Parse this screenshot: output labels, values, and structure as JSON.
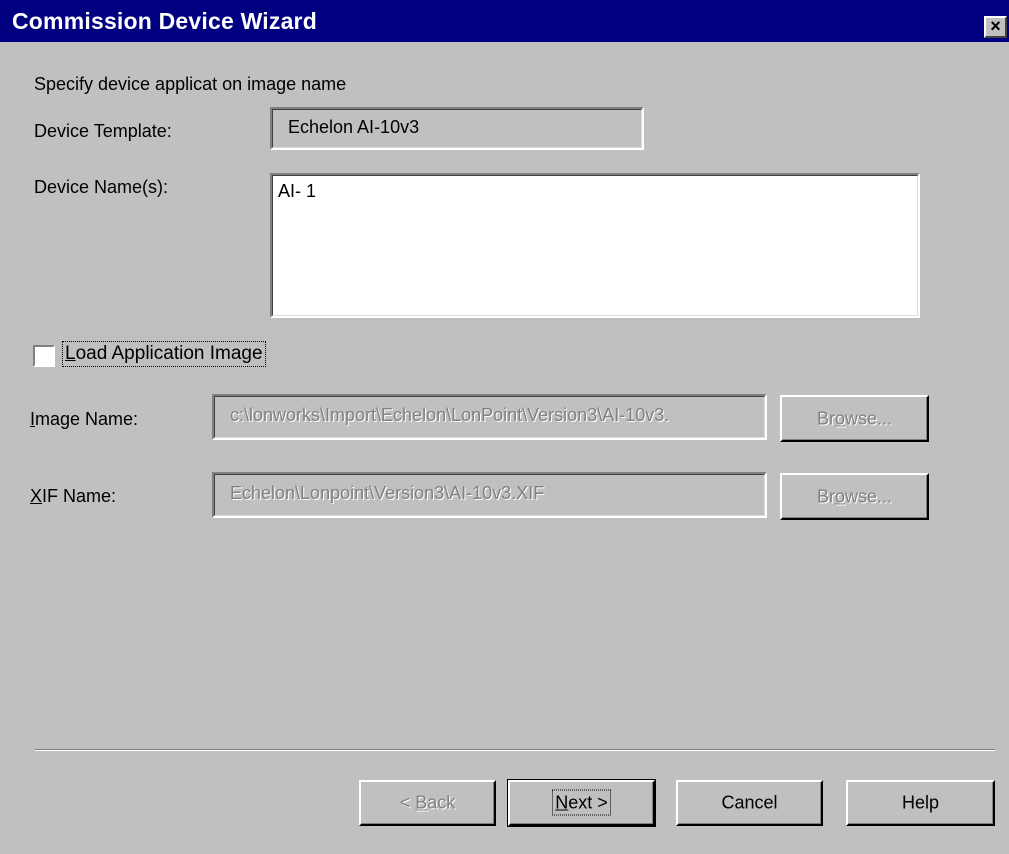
{
  "window": {
    "title": "Commission Device Wizard",
    "close_label": "×"
  },
  "instruction": "Specify device applicat on image name",
  "device_template": {
    "label": "Device Template:",
    "value": "Echelon AI-10v3"
  },
  "device_names": {
    "label": "Device Name(s):",
    "value": "AI- 1"
  },
  "load_image": {
    "label_key_letter": "L",
    "label_rest": "oad Application Image",
    "checked": false
  },
  "image_name": {
    "label_key_letter": "I",
    "label_rest": "mage Name:",
    "value": "c:\\lonworks\\Import\\Echelon\\LonPoint\\Version3\\AI-10v3.",
    "browse_prefix": "Br",
    "browse_key_letter": "o",
    "browse_rest": "wse..."
  },
  "xif_name": {
    "label_key_letter": "X",
    "label_rest": "IF Name:",
    "value": "Echelon\\Lonpoint\\Version3\\AI-10v3.XIF",
    "browse_prefix": "Br",
    "browse_key_letter": "o",
    "browse_rest": "wse..."
  },
  "buttons": {
    "back_prefix": "< ",
    "back_key_letter": "B",
    "back_rest": "ack",
    "next_key_letter": "N",
    "next_rest": "ext >",
    "cancel": "Cancel",
    "help": "Help"
  }
}
